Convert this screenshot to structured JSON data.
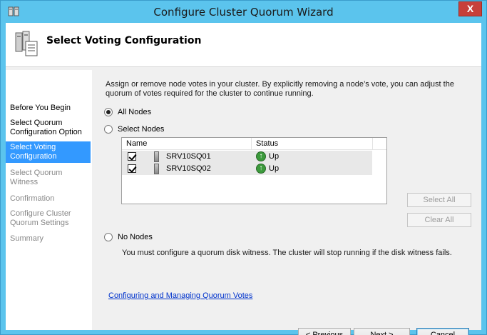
{
  "window": {
    "title": "Configure Cluster Quorum Wizard",
    "close_label": "X"
  },
  "header": {
    "title": "Select Voting Configuration"
  },
  "nav": {
    "items": [
      {
        "label": "Before You Begin",
        "state": "normal"
      },
      {
        "label": "Select Quorum Configuration Option",
        "state": "normal"
      },
      {
        "label": "Select Voting Configuration",
        "state": "active"
      },
      {
        "label": "Select Quorum Witness",
        "state": "disabled"
      },
      {
        "label": "Confirmation",
        "state": "disabled"
      },
      {
        "label": "Configure Cluster Quorum Settings",
        "state": "disabled"
      },
      {
        "label": "Summary",
        "state": "disabled"
      }
    ]
  },
  "content": {
    "intro": "Assign or remove node votes in your cluster. By explicitly removing a node’s vote, you can adjust the quorum of votes required for the cluster to continue running.",
    "options": {
      "all_nodes": {
        "label": "All Nodes",
        "checked": true
      },
      "select_nodes": {
        "label": "Select Nodes",
        "checked": false
      },
      "no_nodes": {
        "label": "No Nodes",
        "checked": false
      }
    },
    "table": {
      "headers": {
        "name": "Name",
        "status": "Status"
      },
      "rows": [
        {
          "name": "SRV10SQ01",
          "status": "Up",
          "checked": true
        },
        {
          "name": "SRV10SQ02",
          "status": "Up",
          "checked": true
        }
      ]
    },
    "select_all_label": "Select All",
    "clear_all_label": "Clear All",
    "no_nodes_warning": "You must configure a quorum disk witness. The cluster will stop running if the disk witness fails.",
    "help_link": "Configuring and Managing Quorum Votes"
  },
  "footer": {
    "previous_label": "< Previous",
    "next_label": "Next >",
    "cancel_label": "Cancel"
  },
  "colors": {
    "frame": "#5bc4ed",
    "nav_active": "#3399ff",
    "close_button": "#c7403a",
    "link": "#0033cc"
  }
}
